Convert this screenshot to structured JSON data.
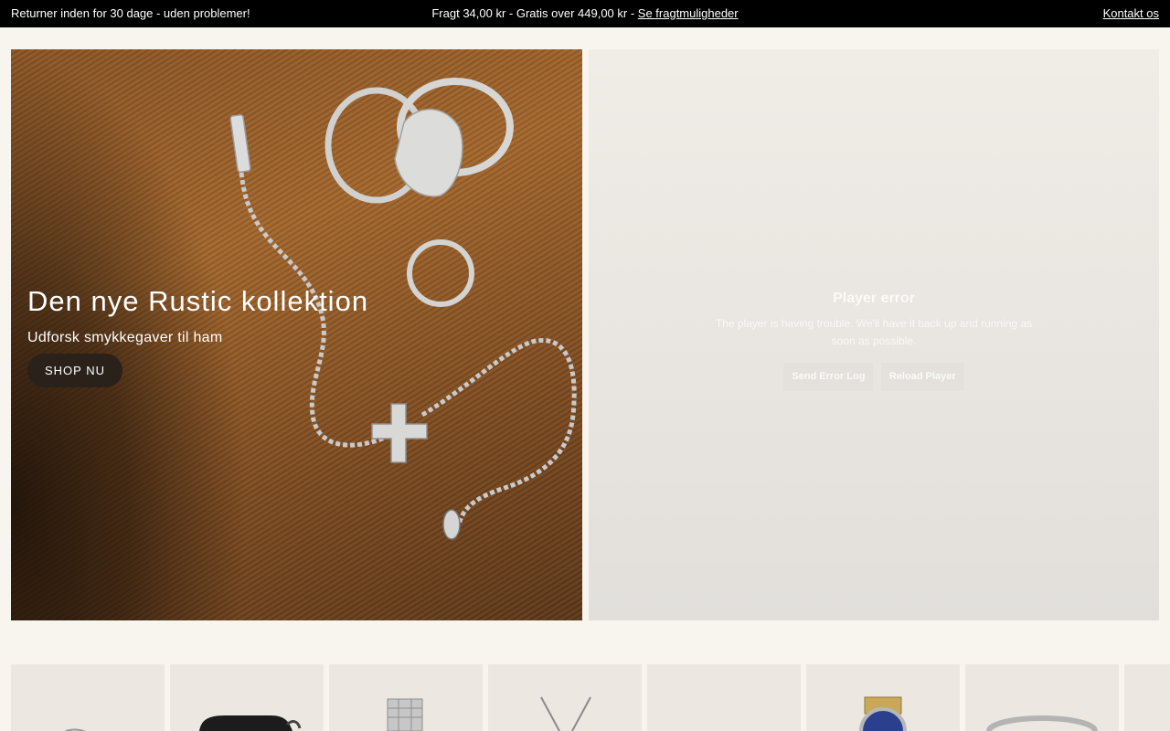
{
  "announcement": {
    "left_text": "Returner inden for 30 dage - uden problemer!",
    "center_text": "Fragt 34,00 kr - Gratis over 449,00 kr - ",
    "center_link": "Se fragtmuligheder",
    "right_link": "Kontakt os"
  },
  "hero": {
    "title": "Den nye Rustic kollektion",
    "subtitle": "Udforsk smykkegaver til ham",
    "cta_label": "SHOP NU"
  },
  "player": {
    "error_title": "Player error",
    "error_message": "The player is having trouble. We'll have it back up and running as soon as possible.",
    "send_log_label": "Send Error Log",
    "reload_label": "Reload Player"
  },
  "products": [
    {
      "icon": "bracelet-icon"
    },
    {
      "icon": "pouch-icon"
    },
    {
      "icon": "watch-steel-icon"
    },
    {
      "icon": "necklace-icon"
    },
    {
      "icon": "empty-card"
    },
    {
      "icon": "watch-two-tone-icon"
    },
    {
      "icon": "ring-icon"
    },
    {
      "icon": "partial-card"
    }
  ]
}
